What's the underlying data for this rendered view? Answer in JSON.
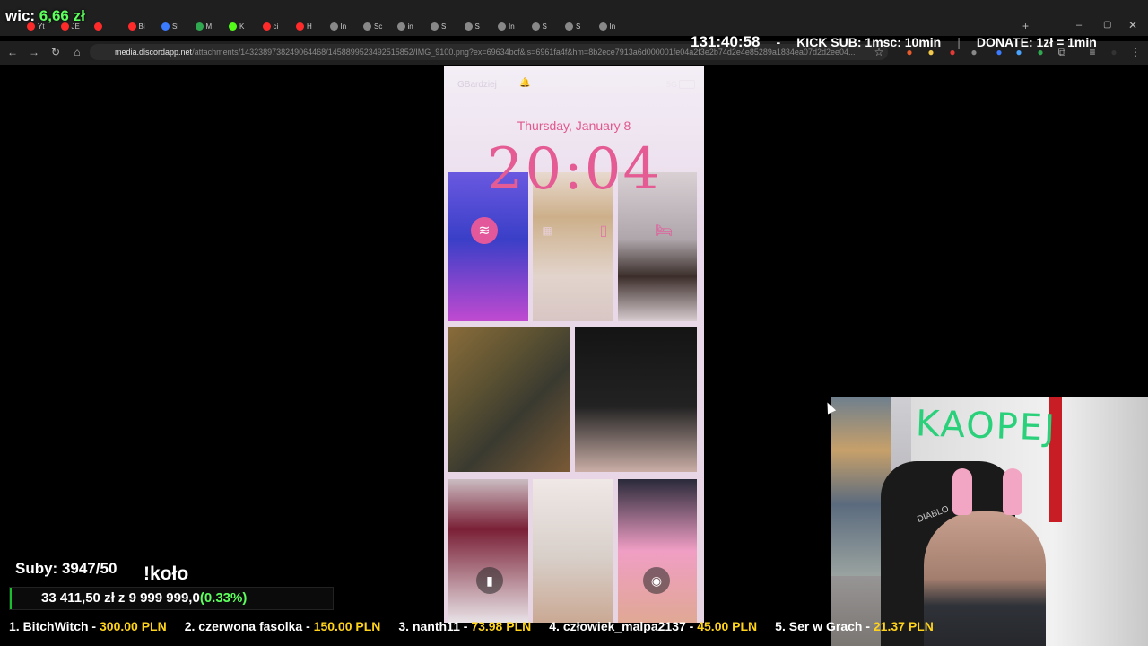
{
  "overlay_top": {
    "donation_label": "wic:",
    "donation_amount": "6,66 zł",
    "timer": "131:40:58",
    "dash": "-",
    "kick_sub": "KICK SUB: 1msc: 10min",
    "separator": "|",
    "donate": "DONATE: 1zł = 1min"
  },
  "browser": {
    "tabs": [
      {
        "label": "Yt",
        "color": "#ff2b2b"
      },
      {
        "label": "JE",
        "color": "#ff2b2b"
      },
      {
        "label": "",
        "color": "#ff2b2b"
      },
      {
        "label": "Bi",
        "color": "#ff2b2b"
      },
      {
        "label": "Sl",
        "color": "#3b7bff"
      },
      {
        "label": "M",
        "color": "#2fa84f"
      },
      {
        "label": "K",
        "color": "#53fc18"
      },
      {
        "label": "ci",
        "color": "#ff2b2b"
      },
      {
        "label": "H",
        "color": "#ff2b2b"
      },
      {
        "label": "In",
        "color": "#888888"
      },
      {
        "label": "Sc",
        "color": "#888888"
      },
      {
        "label": "in",
        "color": "#888888"
      },
      {
        "label": "S",
        "color": "#888888"
      },
      {
        "label": "S",
        "color": "#888888"
      },
      {
        "label": "In",
        "color": "#888888"
      },
      {
        "label": "S",
        "color": "#888888"
      },
      {
        "label": "S",
        "color": "#888888"
      },
      {
        "label": "In",
        "color": "#888888"
      }
    ],
    "url_host": "media.discordapp.net",
    "url_path": "/attachments/1432389738249064468/1458899523492515852/IMG_9100.png?ex=69634bcf&is=6961fa4f&hm=8b2ece7913a6d000001fe04a2f3e2b74d2e4e85289a1834ea07d2d2ee04..."
  },
  "phone": {
    "carrier": "GBardziej",
    "network": "5G",
    "date": "Thursday, January 8",
    "time": "20:04"
  },
  "overlay_bottom": {
    "subs": "Suby: 3947/50",
    "kolo": "!koło",
    "goal_current": "33 411,50 zł z",
    "goal_target": "9 999 999,0",
    "goal_percent": "(0.33%)",
    "goal_fraction": 0.0033
  },
  "ticker": [
    {
      "rank": "1. BitchWitch - ",
      "amount": "300.00 PLN"
    },
    {
      "rank": "2. czerwona fasolka - ",
      "amount": "150.00 PLN"
    },
    {
      "rank": "3. nanth11 - ",
      "amount": "73.98 PLN"
    },
    {
      "rank": "4. człowiek_malpa2137 - ",
      "amount": "45.00 PLN"
    },
    {
      "rank": "5. Ser w Grach - ",
      "amount": "21.37 PLN"
    }
  ],
  "webcam": {
    "wall_text": "KAOPEJ",
    "chair_text": "DIABLO"
  },
  "colors": {
    "accent_green": "#5cff5c",
    "ticker_amount": "#ffd31a",
    "clock_pink": "#e55b93"
  }
}
